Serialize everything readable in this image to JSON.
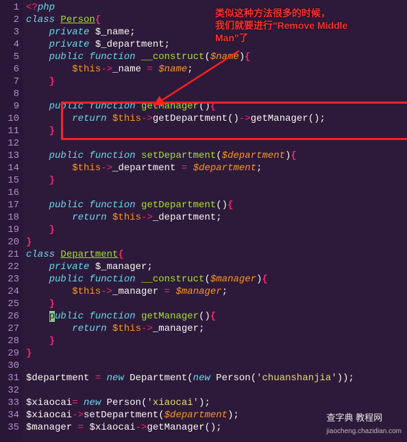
{
  "annotation": {
    "line1": "类似这种方法很多的时候，",
    "line2": "我们就要进行\"Remove Middle",
    "line3": "Man\"了"
  },
  "lines": [
    {
      "n": 1,
      "tokens": [
        {
          "t": "<?",
          "c": "op"
        },
        {
          "t": "php",
          "c": "kw"
        }
      ]
    },
    {
      "n": 2,
      "tokens": [
        {
          "t": "class ",
          "c": "kw"
        },
        {
          "t": "Person",
          "c": "cls"
        },
        {
          "t": "{",
          "c": "br"
        }
      ]
    },
    {
      "n": 3,
      "tokens": [
        {
          "t": "    ",
          "c": ""
        },
        {
          "t": "private ",
          "c": "kw"
        },
        {
          "t": "$_name",
          "c": "mem"
        },
        {
          "t": ";",
          "c": "pn"
        }
      ]
    },
    {
      "n": 4,
      "tokens": [
        {
          "t": "    ",
          "c": ""
        },
        {
          "t": "private ",
          "c": "kw"
        },
        {
          "t": "$_department",
          "c": "mem"
        },
        {
          "t": ";",
          "c": "pn"
        }
      ]
    },
    {
      "n": 5,
      "tokens": [
        {
          "t": "    ",
          "c": ""
        },
        {
          "t": "public ",
          "c": "kw"
        },
        {
          "t": "function ",
          "c": "kw"
        },
        {
          "t": "__construct",
          "c": "fn"
        },
        {
          "t": "(",
          "c": "pn"
        },
        {
          "t": "$name",
          "c": "var"
        },
        {
          "t": ")",
          "c": "pn"
        },
        {
          "t": "{",
          "c": "br"
        }
      ]
    },
    {
      "n": 6,
      "tokens": [
        {
          "t": "        ",
          "c": ""
        },
        {
          "t": "$this",
          "c": "this"
        },
        {
          "t": "->",
          "c": "op"
        },
        {
          "t": "_name ",
          "c": "mem"
        },
        {
          "t": "= ",
          "c": "op"
        },
        {
          "t": "$name",
          "c": "var"
        },
        {
          "t": ";",
          "c": "pn"
        }
      ]
    },
    {
      "n": 7,
      "tokens": [
        {
          "t": "    ",
          "c": ""
        },
        {
          "t": "}",
          "c": "br"
        }
      ]
    },
    {
      "n": 8,
      "tokens": []
    },
    {
      "n": 9,
      "tokens": [
        {
          "t": "    ",
          "c": ""
        },
        {
          "t": "public ",
          "c": "kw"
        },
        {
          "t": "function ",
          "c": "kw"
        },
        {
          "t": "getManager",
          "c": "fn"
        },
        {
          "t": "()",
          "c": "pn"
        },
        {
          "t": "{",
          "c": "br"
        }
      ]
    },
    {
      "n": 10,
      "tokens": [
        {
          "t": "        ",
          "c": ""
        },
        {
          "t": "return ",
          "c": "kw"
        },
        {
          "t": "$this",
          "c": "this"
        },
        {
          "t": "->",
          "c": "op"
        },
        {
          "t": "getDepartment",
          "c": "mem"
        },
        {
          "t": "()",
          "c": "pn"
        },
        {
          "t": "->",
          "c": "op"
        },
        {
          "t": "getManager",
          "c": "mem"
        },
        {
          "t": "()",
          "c": "pn"
        },
        {
          "t": ";",
          "c": "pn"
        }
      ]
    },
    {
      "n": 11,
      "tokens": [
        {
          "t": "    ",
          "c": ""
        },
        {
          "t": "}",
          "c": "br"
        }
      ]
    },
    {
      "n": 12,
      "tokens": []
    },
    {
      "n": 13,
      "tokens": [
        {
          "t": "    ",
          "c": ""
        },
        {
          "t": "public ",
          "c": "kw"
        },
        {
          "t": "function ",
          "c": "kw"
        },
        {
          "t": "setDepartment",
          "c": "fn"
        },
        {
          "t": "(",
          "c": "pn"
        },
        {
          "t": "$department",
          "c": "var"
        },
        {
          "t": ")",
          "c": "pn"
        },
        {
          "t": "{",
          "c": "br"
        }
      ]
    },
    {
      "n": 14,
      "tokens": [
        {
          "t": "        ",
          "c": ""
        },
        {
          "t": "$this",
          "c": "this"
        },
        {
          "t": "->",
          "c": "op"
        },
        {
          "t": "_department ",
          "c": "mem"
        },
        {
          "t": "= ",
          "c": "op"
        },
        {
          "t": "$department",
          "c": "var"
        },
        {
          "t": ";",
          "c": "pn"
        }
      ]
    },
    {
      "n": 15,
      "tokens": [
        {
          "t": "    ",
          "c": ""
        },
        {
          "t": "}",
          "c": "br"
        }
      ]
    },
    {
      "n": 16,
      "tokens": []
    },
    {
      "n": 17,
      "tokens": [
        {
          "t": "    ",
          "c": ""
        },
        {
          "t": "public ",
          "c": "kw"
        },
        {
          "t": "function ",
          "c": "kw"
        },
        {
          "t": "getDepartment",
          "c": "fn"
        },
        {
          "t": "()",
          "c": "pn"
        },
        {
          "t": "{",
          "c": "br"
        }
      ]
    },
    {
      "n": 18,
      "tokens": [
        {
          "t": "        ",
          "c": ""
        },
        {
          "t": "return ",
          "c": "kw"
        },
        {
          "t": "$this",
          "c": "this"
        },
        {
          "t": "->",
          "c": "op"
        },
        {
          "t": "_department",
          "c": "mem"
        },
        {
          "t": ";",
          "c": "pn"
        }
      ]
    },
    {
      "n": 19,
      "tokens": [
        {
          "t": "    ",
          "c": ""
        },
        {
          "t": "}",
          "c": "br"
        }
      ]
    },
    {
      "n": 20,
      "tokens": [
        {
          "t": "}",
          "c": "br"
        }
      ]
    },
    {
      "n": 21,
      "tokens": [
        {
          "t": "class ",
          "c": "kw"
        },
        {
          "t": "Department",
          "c": "cls"
        },
        {
          "t": "{",
          "c": "br"
        }
      ]
    },
    {
      "n": 22,
      "tokens": [
        {
          "t": "    ",
          "c": ""
        },
        {
          "t": "private ",
          "c": "kw"
        },
        {
          "t": "$_manager",
          "c": "mem"
        },
        {
          "t": ";",
          "c": "pn"
        }
      ]
    },
    {
      "n": 23,
      "tokens": [
        {
          "t": "    ",
          "c": ""
        },
        {
          "t": "public ",
          "c": "kw"
        },
        {
          "t": "function ",
          "c": "kw"
        },
        {
          "t": "__construct",
          "c": "fn"
        },
        {
          "t": "(",
          "c": "pn"
        },
        {
          "t": "$manager",
          "c": "var"
        },
        {
          "t": ")",
          "c": "pn"
        },
        {
          "t": "{",
          "c": "br"
        }
      ]
    },
    {
      "n": 24,
      "tokens": [
        {
          "t": "        ",
          "c": ""
        },
        {
          "t": "$this",
          "c": "this"
        },
        {
          "t": "->",
          "c": "op"
        },
        {
          "t": "_manager ",
          "c": "mem"
        },
        {
          "t": "= ",
          "c": "op"
        },
        {
          "t": "$manager",
          "c": "var"
        },
        {
          "t": ";",
          "c": "pn"
        }
      ]
    },
    {
      "n": 25,
      "tokens": [
        {
          "t": "    ",
          "c": ""
        },
        {
          "t": "}",
          "c": "br"
        }
      ]
    },
    {
      "n": 26,
      "tokens": [
        {
          "t": "    ",
          "c": ""
        },
        {
          "t": "p",
          "c": "cursor"
        },
        {
          "t": "ublic ",
          "c": "kw"
        },
        {
          "t": "function ",
          "c": "kw"
        },
        {
          "t": "getManager",
          "c": "fn"
        },
        {
          "t": "()",
          "c": "pn"
        },
        {
          "t": "{",
          "c": "br"
        }
      ]
    },
    {
      "n": 27,
      "tokens": [
        {
          "t": "        ",
          "c": ""
        },
        {
          "t": "return ",
          "c": "kw"
        },
        {
          "t": "$this",
          "c": "this"
        },
        {
          "t": "->",
          "c": "op"
        },
        {
          "t": "_manager",
          "c": "mem"
        },
        {
          "t": ";",
          "c": "pn"
        }
      ]
    },
    {
      "n": 28,
      "tokens": [
        {
          "t": "    ",
          "c": ""
        },
        {
          "t": "}",
          "c": "br"
        }
      ]
    },
    {
      "n": 29,
      "tokens": [
        {
          "t": "}",
          "c": "br"
        }
      ]
    },
    {
      "n": 30,
      "tokens": []
    },
    {
      "n": 31,
      "tokens": [
        {
          "t": "$department ",
          "c": "mem"
        },
        {
          "t": "= ",
          "c": "op"
        },
        {
          "t": "new ",
          "c": "kw"
        },
        {
          "t": "Department",
          "c": "mem"
        },
        {
          "t": "(",
          "c": "pn"
        },
        {
          "t": "new ",
          "c": "kw"
        },
        {
          "t": "Person",
          "c": "mem"
        },
        {
          "t": "(",
          "c": "pn"
        },
        {
          "t": "'chuanshanjia'",
          "c": "str"
        },
        {
          "t": "))",
          "c": "pn"
        },
        {
          "t": ";",
          "c": "pn"
        }
      ]
    },
    {
      "n": 32,
      "tokens": []
    },
    {
      "n": 33,
      "tokens": [
        {
          "t": "$xiaocai",
          "c": "mem"
        },
        {
          "t": "= ",
          "c": "op"
        },
        {
          "t": "new ",
          "c": "kw"
        },
        {
          "t": "Person",
          "c": "mem"
        },
        {
          "t": "(",
          "c": "pn"
        },
        {
          "t": "'xiaocai'",
          "c": "str"
        },
        {
          "t": ")",
          "c": "pn"
        },
        {
          "t": ";",
          "c": "pn"
        }
      ]
    },
    {
      "n": 34,
      "tokens": [
        {
          "t": "$xiaocai",
          "c": "mem"
        },
        {
          "t": "->",
          "c": "op"
        },
        {
          "t": "setDepartment",
          "c": "mem"
        },
        {
          "t": "(",
          "c": "pn"
        },
        {
          "t": "$department",
          "c": "var"
        },
        {
          "t": ")",
          "c": "pn"
        },
        {
          "t": ";",
          "c": "pn"
        }
      ]
    },
    {
      "n": 35,
      "tokens": [
        {
          "t": "$manager ",
          "c": "mem"
        },
        {
          "t": "= ",
          "c": "op"
        },
        {
          "t": "$xiaocai",
          "c": "mem"
        },
        {
          "t": "->",
          "c": "op"
        },
        {
          "t": "getManager",
          "c": "mem"
        },
        {
          "t": "()",
          "c": "pn"
        },
        {
          "t": ";",
          "c": "pn"
        }
      ]
    }
  ],
  "watermark": {
    "main": "查字典 教程网",
    "sub": "jiaocheng.chazidian.com"
  }
}
